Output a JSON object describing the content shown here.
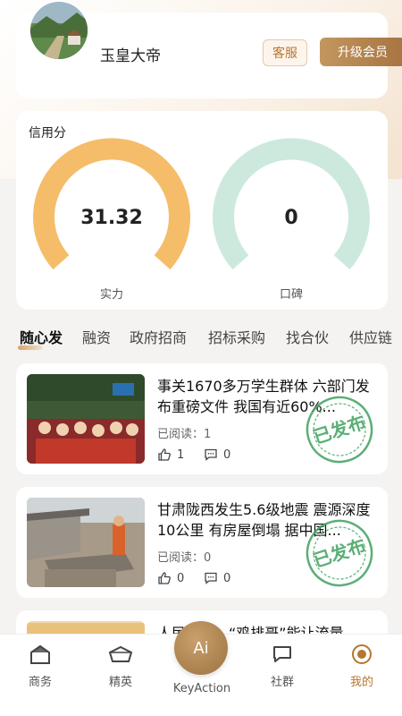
{
  "profile": {
    "username": "玉皇大帝",
    "service_label": "客服",
    "vip_label": "升级会员"
  },
  "credit": {
    "title": "信用分",
    "gauges": [
      {
        "label": "实力",
        "value": "31.32",
        "color": "#f5bd69"
      },
      {
        "label": "口碑",
        "value": "0",
        "color": "#cde9dd"
      }
    ]
  },
  "tabs": [
    "随心发",
    "融资",
    "政府招商",
    "招标采购",
    "找合伙",
    "供应链"
  ],
  "news": [
    {
      "title": "事关1670多万学生群体 六部门发布重磅文件 我国有近60%...",
      "reads_label": "已阅读：",
      "reads": "1",
      "likes": "1",
      "comments": "0",
      "stamp": "已发布"
    },
    {
      "title": "甘肃陇西发生5.6级地震 震源深度10公里 有房屋倒塌 据中国...",
      "reads_label": "已阅读：",
      "reads": "0",
      "likes": "0",
      "comments": "0",
      "stamp": "已发布"
    },
    {
      "title": "人民日报：“鸡排哥”能让流量"
    }
  ],
  "nav": {
    "items": [
      {
        "label": "商务",
        "icon": "building-icon"
      },
      {
        "label": "精英",
        "icon": "diamond-icon"
      },
      {
        "label": "社群",
        "icon": "chat-icon"
      },
      {
        "label": "我的",
        "icon": "profile-icon"
      }
    ],
    "ai_label": "Ai",
    "ai_caption": "KeyAction"
  },
  "colors": {
    "accent": "#b5762e",
    "stamp_green": "#3fa15f"
  }
}
